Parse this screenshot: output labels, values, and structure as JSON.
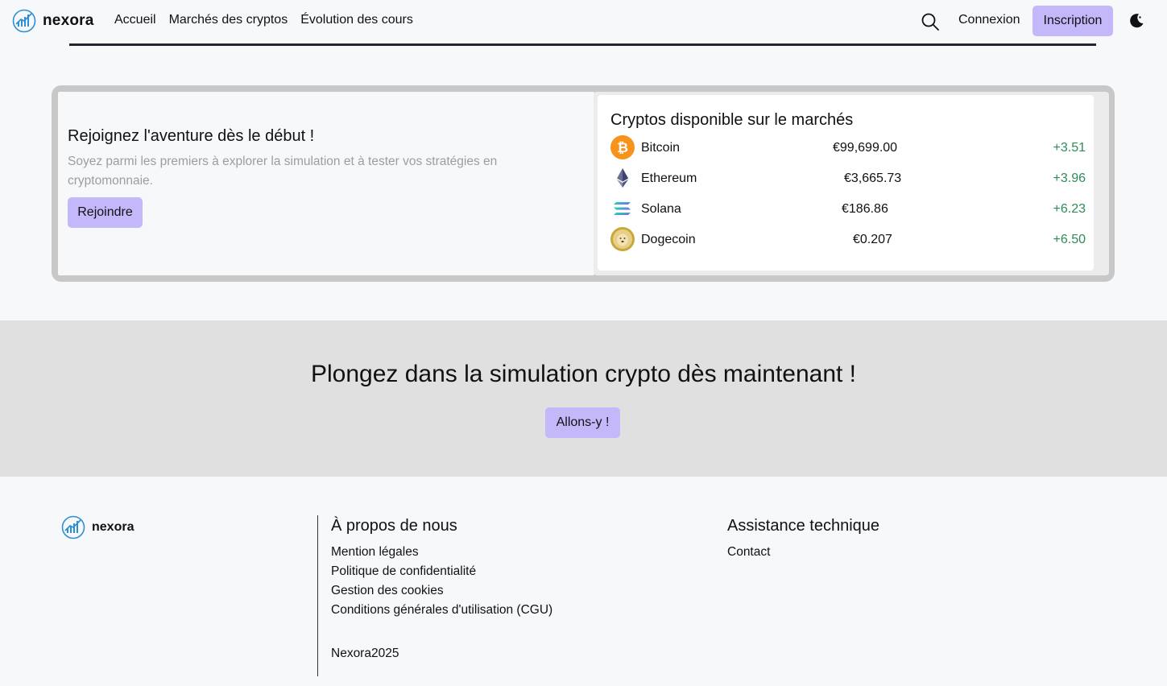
{
  "brand": {
    "name": "nexora",
    "accent": "#c4b8fb",
    "logo_color": "#2a8fd4"
  },
  "nav": {
    "links": [
      "Accueil",
      "Marchés des cryptos",
      "Évolution des cours"
    ],
    "login": "Connexion",
    "signup": "Inscription",
    "search_icon": "search-icon",
    "theme_icon": "moon-icon"
  },
  "hero": {
    "title": "Rejoignez l'aventure dès le début !",
    "description": "Soyez parmi les premiers à explorer la simulation et à tester vos stratégies en cryptomonnaie.",
    "button": "Rejoindre"
  },
  "cryptos": {
    "title": "Cryptos disponible sur le marchés",
    "items": [
      {
        "name": "Bitcoin",
        "price": "€99,699.00",
        "change": "+3.51",
        "icon": "bitcoin-icon"
      },
      {
        "name": "Ethereum",
        "price": "€3,665.73",
        "change": "+3.96",
        "icon": "ethereum-icon"
      },
      {
        "name": "Solana",
        "price": "€186.86",
        "change": "+6.23",
        "icon": "solana-icon"
      },
      {
        "name": "Dogecoin",
        "price": "€0.207",
        "change": "+6.50",
        "icon": "dogecoin-icon"
      }
    ]
  },
  "cta": {
    "title": "Plongez dans la simulation crypto dès maintenant !",
    "button": "Allons-y !"
  },
  "footer": {
    "brand": "nexora",
    "about": {
      "heading": "À propos de nous",
      "links": [
        "Mention légales",
        "Politique de confidentialité",
        "Gestion des cookies",
        "Conditions générales d'utilisation (CGU)"
      ]
    },
    "support": {
      "heading": "Assistance technique",
      "links": [
        "Contact"
      ]
    },
    "copyright": "Nexora2025"
  }
}
